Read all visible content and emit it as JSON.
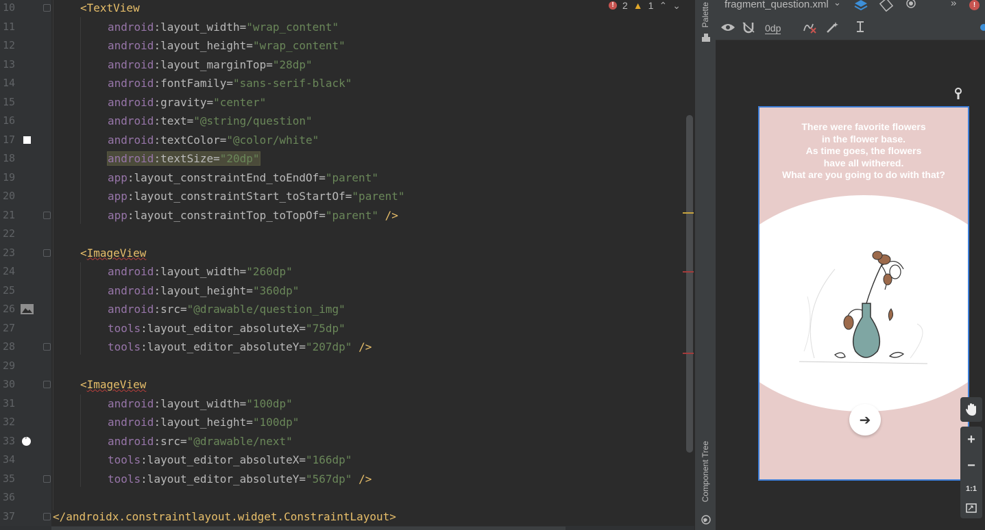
{
  "editor": {
    "lines": [
      {
        "n": "10",
        "indent": 1,
        "parts": [
          {
            "t": "<TextView",
            "c": "tag"
          }
        ]
      },
      {
        "n": "11",
        "indent": 2,
        "parts": [
          {
            "t": "android",
            "c": "ns"
          },
          {
            "t": ":layout_width=",
            "c": "attr"
          },
          {
            "t": "\"wrap_content\"",
            "c": "val"
          }
        ]
      },
      {
        "n": "12",
        "indent": 2,
        "parts": [
          {
            "t": "android",
            "c": "ns"
          },
          {
            "t": ":layout_height=",
            "c": "attr"
          },
          {
            "t": "\"wrap_content\"",
            "c": "val"
          }
        ]
      },
      {
        "n": "13",
        "indent": 2,
        "parts": [
          {
            "t": "android",
            "c": "ns"
          },
          {
            "t": ":layout_marginTop=",
            "c": "attr"
          },
          {
            "t": "\"28dp\"",
            "c": "val"
          }
        ]
      },
      {
        "n": "14",
        "indent": 2,
        "parts": [
          {
            "t": "android",
            "c": "ns"
          },
          {
            "t": ":fontFamily=",
            "c": "attr"
          },
          {
            "t": "\"sans-serif-black\"",
            "c": "val"
          }
        ]
      },
      {
        "n": "15",
        "indent": 2,
        "parts": [
          {
            "t": "android",
            "c": "ns"
          },
          {
            "t": ":gravity=",
            "c": "attr"
          },
          {
            "t": "\"center\"",
            "c": "val"
          }
        ]
      },
      {
        "n": "16",
        "indent": 2,
        "parts": [
          {
            "t": "android",
            "c": "ns"
          },
          {
            "t": ":text=",
            "c": "attr"
          },
          {
            "t": "\"@string/question\"",
            "c": "val"
          }
        ]
      },
      {
        "n": "17",
        "indent": 2,
        "gutter_icon": "white-square",
        "parts": [
          {
            "t": "android",
            "c": "ns"
          },
          {
            "t": ":textColor=",
            "c": "attr"
          },
          {
            "t": "\"@color/white\"",
            "c": "val"
          }
        ]
      },
      {
        "n": "18",
        "indent": 2,
        "highlight": true,
        "parts": [
          {
            "t": "android",
            "c": "ns"
          },
          {
            "t": ":textSize=",
            "c": "attr"
          },
          {
            "t": "\"20dp\"",
            "c": "val"
          }
        ]
      },
      {
        "n": "19",
        "indent": 2,
        "parts": [
          {
            "t": "app",
            "c": "ns"
          },
          {
            "t": ":layout_constraintEnd_toEndOf=",
            "c": "attr"
          },
          {
            "t": "\"parent\"",
            "c": "val"
          }
        ]
      },
      {
        "n": "20",
        "indent": 2,
        "parts": [
          {
            "t": "app",
            "c": "ns"
          },
          {
            "t": ":layout_constraintStart_toStartOf=",
            "c": "attr"
          },
          {
            "t": "\"parent\"",
            "c": "val"
          }
        ]
      },
      {
        "n": "21",
        "indent": 2,
        "parts": [
          {
            "t": "app",
            "c": "ns"
          },
          {
            "t": ":layout_constraintTop_toTopOf=",
            "c": "attr"
          },
          {
            "t": "\"parent\"",
            "c": "val"
          },
          {
            "t": " />",
            "c": "punct"
          }
        ]
      },
      {
        "n": "22",
        "indent": 0,
        "parts": []
      },
      {
        "n": "23",
        "indent": 1,
        "parts": [
          {
            "t": "<",
            "c": "tag"
          },
          {
            "t": "ImageView",
            "c": "tag squig"
          }
        ]
      },
      {
        "n": "24",
        "indent": 2,
        "parts": [
          {
            "t": "android",
            "c": "ns"
          },
          {
            "t": ":layout_width=",
            "c": "attr"
          },
          {
            "t": "\"260dp\"",
            "c": "val"
          }
        ]
      },
      {
        "n": "25",
        "indent": 2,
        "parts": [
          {
            "t": "android",
            "c": "ns"
          },
          {
            "t": ":layout_height=",
            "c": "attr"
          },
          {
            "t": "\"360dp\"",
            "c": "val"
          }
        ]
      },
      {
        "n": "26",
        "indent": 2,
        "gutter_icon": "image",
        "parts": [
          {
            "t": "android",
            "c": "ns"
          },
          {
            "t": ":src=",
            "c": "attr"
          },
          {
            "t": "\"@drawable/question_img\"",
            "c": "val"
          }
        ]
      },
      {
        "n": "27",
        "indent": 2,
        "parts": [
          {
            "t": "tools",
            "c": "ns"
          },
          {
            "t": ":layout_editor_absoluteX=",
            "c": "attr"
          },
          {
            "t": "\"75dp\"",
            "c": "val"
          }
        ]
      },
      {
        "n": "28",
        "indent": 2,
        "parts": [
          {
            "t": "tools",
            "c": "ns"
          },
          {
            "t": ":layout_editor_absoluteY=",
            "c": "attr"
          },
          {
            "t": "\"207dp\"",
            "c": "val"
          },
          {
            "t": " />",
            "c": "punct"
          }
        ]
      },
      {
        "n": "29",
        "indent": 0,
        "parts": []
      },
      {
        "n": "30",
        "indent": 1,
        "parts": [
          {
            "t": "<",
            "c": "tag"
          },
          {
            "t": "ImageView",
            "c": "tag squig"
          }
        ]
      },
      {
        "n": "31",
        "indent": 2,
        "parts": [
          {
            "t": "android",
            "c": "ns"
          },
          {
            "t": ":layout_width=",
            "c": "attr"
          },
          {
            "t": "\"100dp\"",
            "c": "val"
          }
        ]
      },
      {
        "n": "32",
        "indent": 2,
        "parts": [
          {
            "t": "android",
            "c": "ns"
          },
          {
            "t": ":layout_height=",
            "c": "attr"
          },
          {
            "t": "\"100dp\"",
            "c": "val"
          }
        ]
      },
      {
        "n": "33",
        "indent": 2,
        "gutter_icon": "arrow-circle",
        "parts": [
          {
            "t": "android",
            "c": "ns"
          },
          {
            "t": ":src=",
            "c": "attr"
          },
          {
            "t": "\"@drawable/next\"",
            "c": "val"
          }
        ]
      },
      {
        "n": "34",
        "indent": 2,
        "parts": [
          {
            "t": "tools",
            "c": "ns"
          },
          {
            "t": ":layout_editor_absoluteX=",
            "c": "attr"
          },
          {
            "t": "\"166dp\"",
            "c": "val"
          }
        ]
      },
      {
        "n": "35",
        "indent": 2,
        "parts": [
          {
            "t": "tools",
            "c": "ns"
          },
          {
            "t": ":layout_editor_absoluteY=",
            "c": "attr"
          },
          {
            "t": "\"567dp\"",
            "c": "val"
          },
          {
            "t": " />",
            "c": "punct"
          }
        ]
      },
      {
        "n": "36",
        "indent": 0,
        "parts": []
      },
      {
        "n": "37",
        "indent": 0,
        "parts": [
          {
            "t": "</androidx.constraintlayout.widget.ConstraintLayout>",
            "c": "tag"
          }
        ]
      }
    ],
    "status": {
      "errors": "2",
      "warnings": "1"
    }
  },
  "side_strip": {
    "palette_label": "Palette",
    "component_tree_label": "Component Tree"
  },
  "design": {
    "file_tab": "fragment_question.xml",
    "margin_value": "0dp",
    "preview": {
      "question_text": "There were favorite flowers\nin the flower base.\nAs time goes, the flowers\nhave all withered.\nWhat are you going to do with that?",
      "next_icon": "➔"
    },
    "zoom": {
      "plus": "+",
      "minus": "−",
      "one_to_one": "1:1"
    }
  },
  "colors": {
    "accent": "#3d7ed8",
    "phone_bg": "#e8ccca",
    "vase": "#7fa6a3",
    "petal": "#9c6a4b"
  }
}
